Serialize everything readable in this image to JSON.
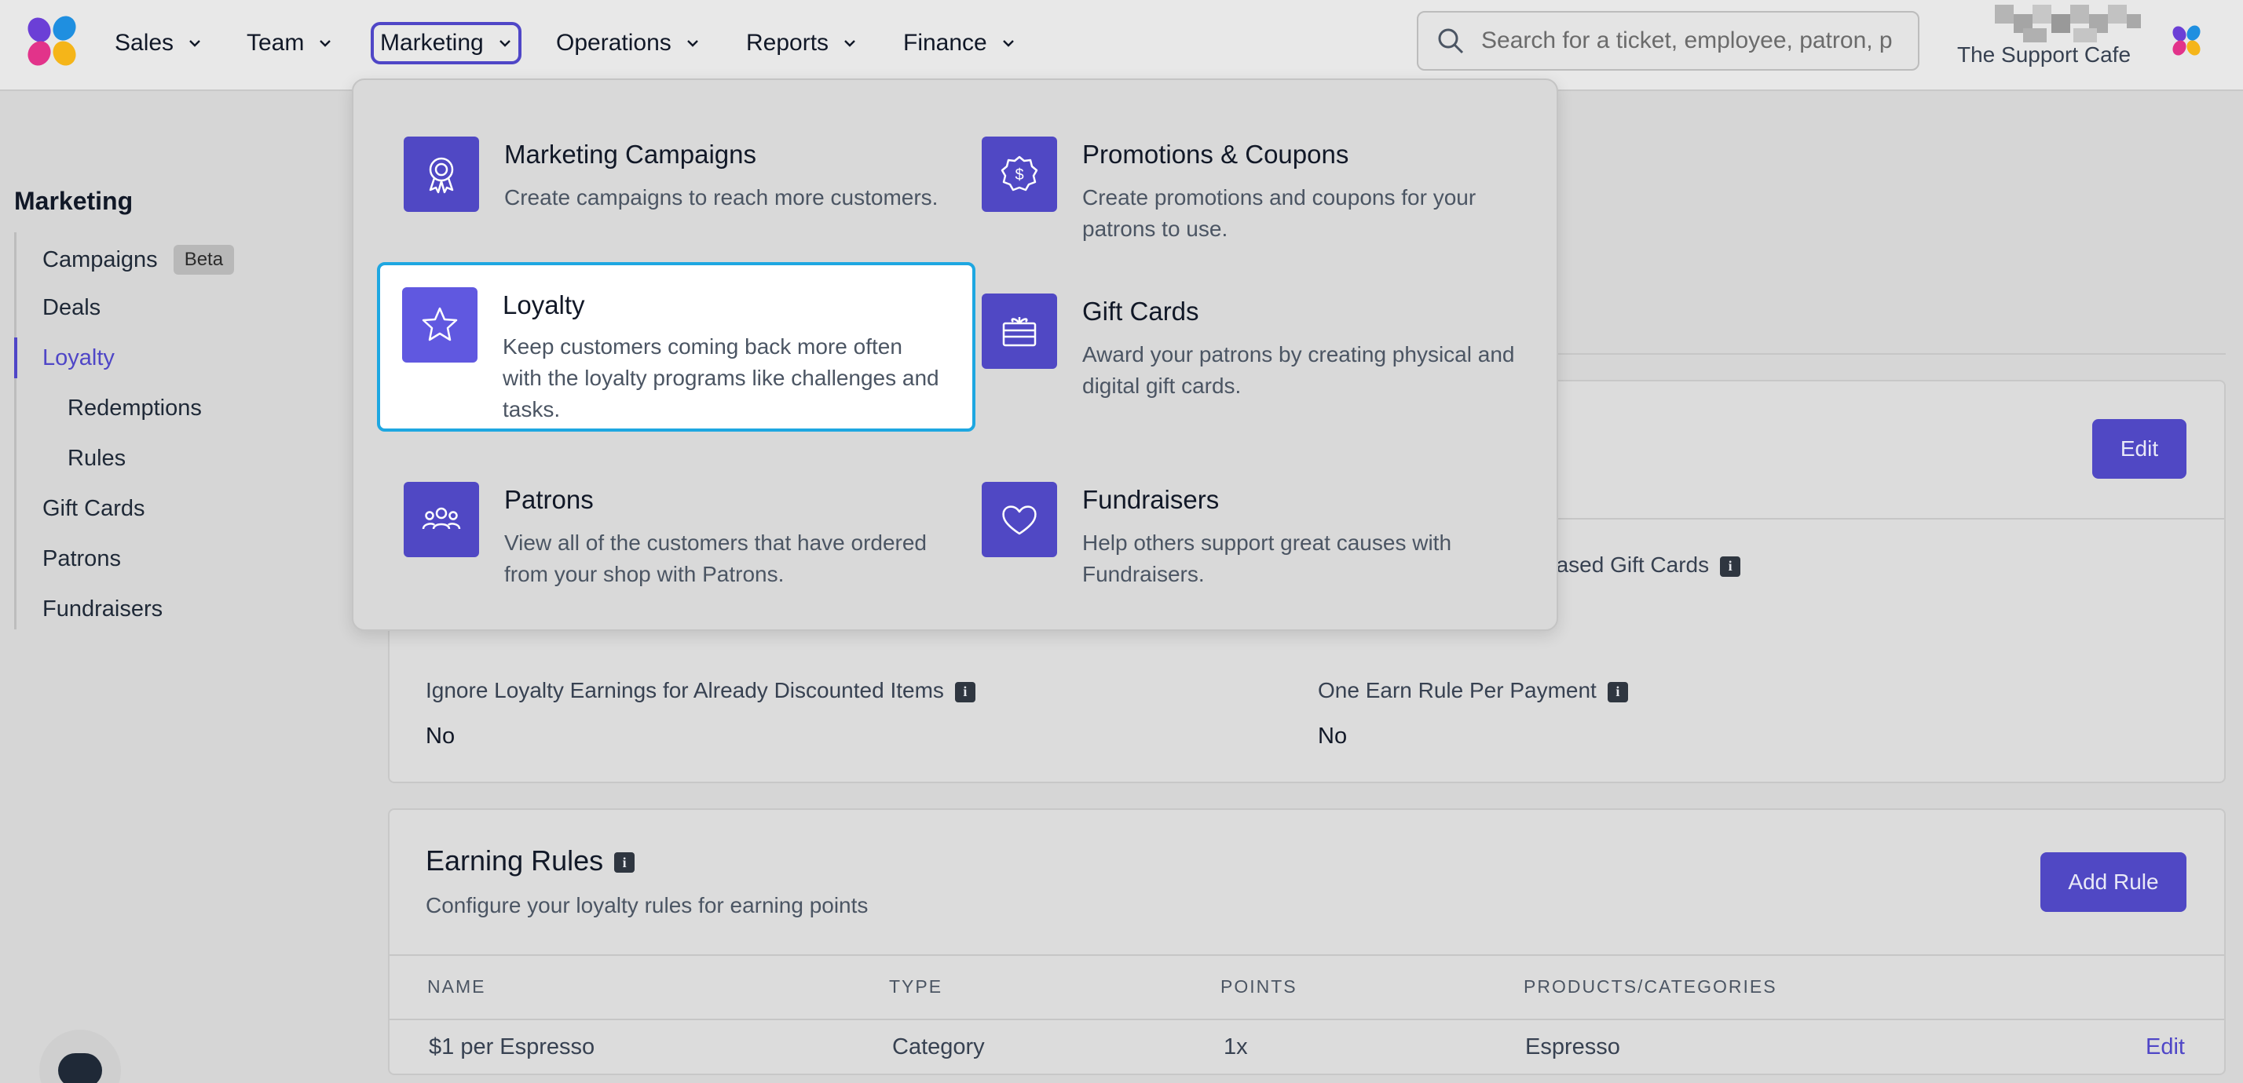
{
  "nav": {
    "items": [
      {
        "label": "Sales"
      },
      {
        "label": "Team"
      },
      {
        "label": "Marketing"
      },
      {
        "label": "Operations"
      },
      {
        "label": "Reports"
      },
      {
        "label": "Finance"
      }
    ],
    "search_placeholder": "Search for a ticket, employee, patron, p",
    "org_name": "The Support Cafe"
  },
  "sidebar": {
    "title": "Marketing",
    "items": [
      {
        "label": "Campaigns",
        "badge": "Beta"
      },
      {
        "label": "Deals"
      },
      {
        "label": "Loyalty"
      },
      {
        "label": "Redemptions"
      },
      {
        "label": "Rules"
      },
      {
        "label": "Gift Cards"
      },
      {
        "label": "Patrons"
      },
      {
        "label": "Fundraisers"
      }
    ]
  },
  "menu": {
    "items": [
      {
        "title": "Marketing Campaigns",
        "desc": "Create campaigns to reach more customers.",
        "icon": "award-ribbon-icon"
      },
      {
        "title": "Promotions & Coupons",
        "desc": "Create promotions and coupons for your patrons to use.",
        "icon": "dollar-badge-icon"
      },
      {
        "title": "Loyalty",
        "desc": "Keep customers coming back more often with the loyalty programs like challenges and tasks.",
        "icon": "star-icon"
      },
      {
        "title": "Gift Cards",
        "desc": "Award your patrons by creating physical and digital gift cards.",
        "icon": "gift-card-icon"
      },
      {
        "title": "Patrons",
        "desc": "View all of the customers that have ordered from your shop with Patrons.",
        "icon": "users-icon"
      },
      {
        "title": "Fundraisers",
        "desc": "Help others support great causes with Fundraisers.",
        "icon": "heart-icon"
      }
    ]
  },
  "settings": {
    "edit_label": "Edit",
    "partial_label": "hased Gift Cards",
    "ignore_label": "Ignore Loyalty Earnings for Already Discounted Items",
    "ignore_value": "No",
    "one_rule_label": "One Earn Rule Per Payment",
    "one_rule_value": "No"
  },
  "earning_rules": {
    "title": "Earning Rules",
    "subtitle": "Configure your loyalty rules for earning points",
    "add_label": "Add Rule",
    "columns": [
      "NAME",
      "TYPE",
      "POINTS",
      "PRODUCTS/CATEGORIES"
    ],
    "rows": [
      {
        "name": "$1 per Espresso",
        "type": "Category",
        "points": "1x",
        "products": "Espresso",
        "action": "Edit"
      }
    ]
  },
  "colors": {
    "accent": "#5048c4",
    "highlight_border": "#1ea7e1"
  }
}
